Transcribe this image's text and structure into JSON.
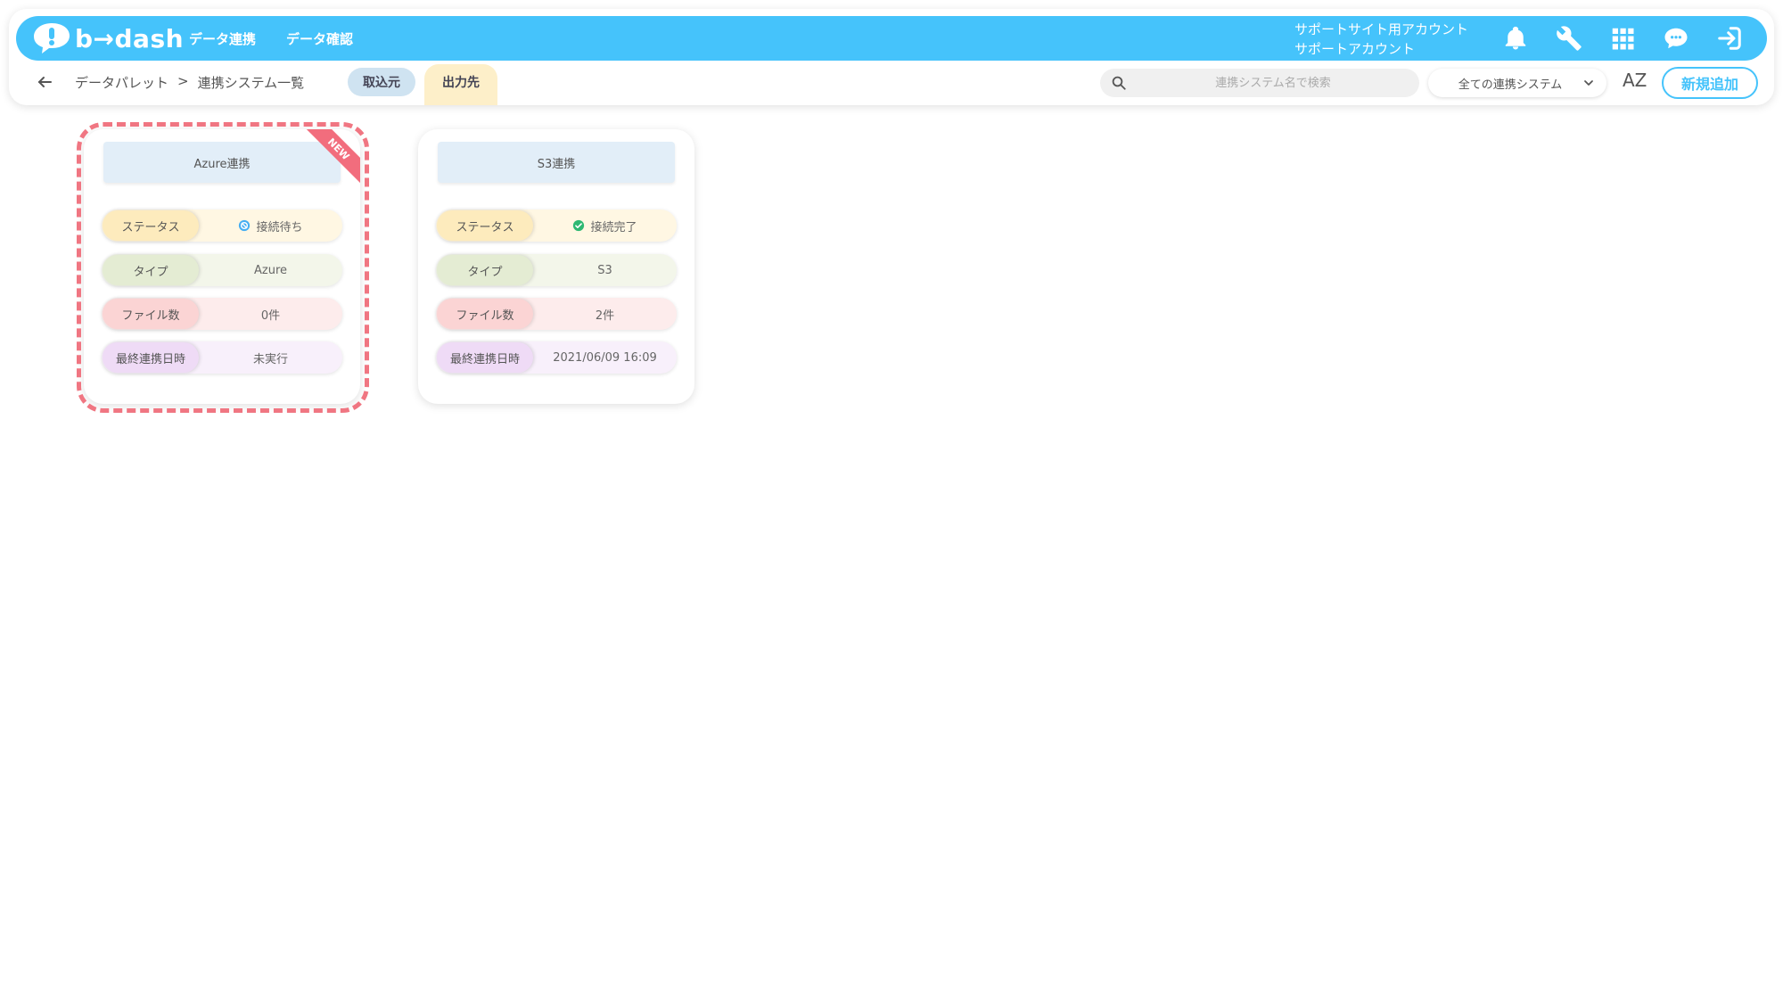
{
  "header": {
    "logo_text": "b→dash",
    "nav": [
      "データ連携",
      "データ確認"
    ],
    "account_line1": "サポートサイト用アカウント",
    "account_line2": "サポートアカウント",
    "icons": [
      "bell-icon",
      "wrench-icon",
      "grid-icon",
      "chat-icon",
      "logout-icon"
    ],
    "accent": "#45c3fb"
  },
  "subbar": {
    "breadcrumb": [
      "データパレット",
      "連携システム一覧"
    ],
    "breadcrumb_sep": ">",
    "tab_source": "取込元",
    "tab_destination": "出力先",
    "search_placeholder": "連携システム名で検索",
    "filter_value": "全ての連携システム",
    "sort_label": "AZ",
    "add_button": "新規追加"
  },
  "cards": [
    {
      "title": "Azure連携",
      "badge": "NEW",
      "status_label": "ステータス",
      "status_value": "接続待ち",
      "type_label": "タイプ",
      "type_value": "Azure",
      "files_label": "ファイル数",
      "files_value": "0件",
      "date_label": "最終連携日時",
      "date_value": "未実行"
    },
    {
      "title": "S3連携",
      "status_label": "ステータス",
      "status_value": "接続完了",
      "type_label": "タイプ",
      "type_value": "S3",
      "files_label": "ファイル数",
      "files_value": "2件",
      "date_label": "最終連携日時",
      "date_value": "2021/06/09 16:09"
    }
  ]
}
